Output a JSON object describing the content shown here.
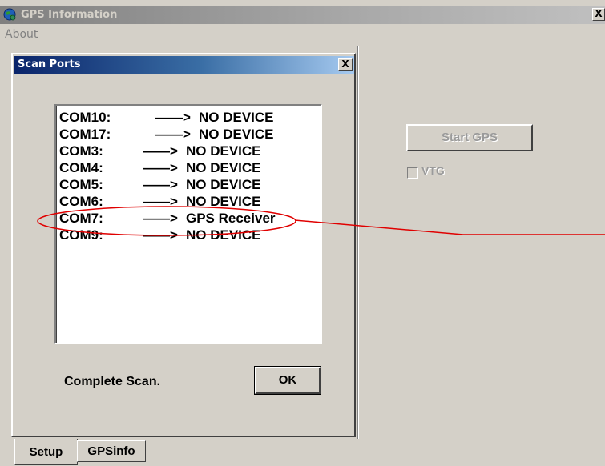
{
  "window": {
    "title": "GPS Information",
    "close_label": "X"
  },
  "menu": {
    "about_label": "About"
  },
  "dialog": {
    "title": "Scan Ports",
    "close_label": "X",
    "ports": [
      {
        "name": "COM10:",
        "status": "NO DEVICE"
      },
      {
        "name": "COM17:",
        "status": "NO DEVICE"
      },
      {
        "name": "COM3:",
        "status": "NO DEVICE"
      },
      {
        "name": "COM4:",
        "status": "NO DEVICE"
      },
      {
        "name": "COM5:",
        "status": "NO DEVICE"
      },
      {
        "name": "COM6:",
        "status": "NO DEVICE"
      },
      {
        "name": "COM7:",
        "status": "GPS Receiver"
      },
      {
        "name": "COM9:",
        "status": "NO DEVICE"
      }
    ],
    "arrow": "——>",
    "scan_status": "Complete Scan.",
    "ok_label": "OK"
  },
  "right_panel": {
    "start_gps_label": "Start GPS",
    "vtg_label": "VTG"
  },
  "tabs": {
    "setup_label": "Setup",
    "gpsinfo_label": "GPSinfo"
  },
  "colors": {
    "annotation": "#e00000",
    "dialog_title_start": "#0a246a",
    "dialog_title_end": "#a6caf0",
    "face": "#d4d0c8"
  },
  "icons": {
    "app": "globe-icon"
  }
}
